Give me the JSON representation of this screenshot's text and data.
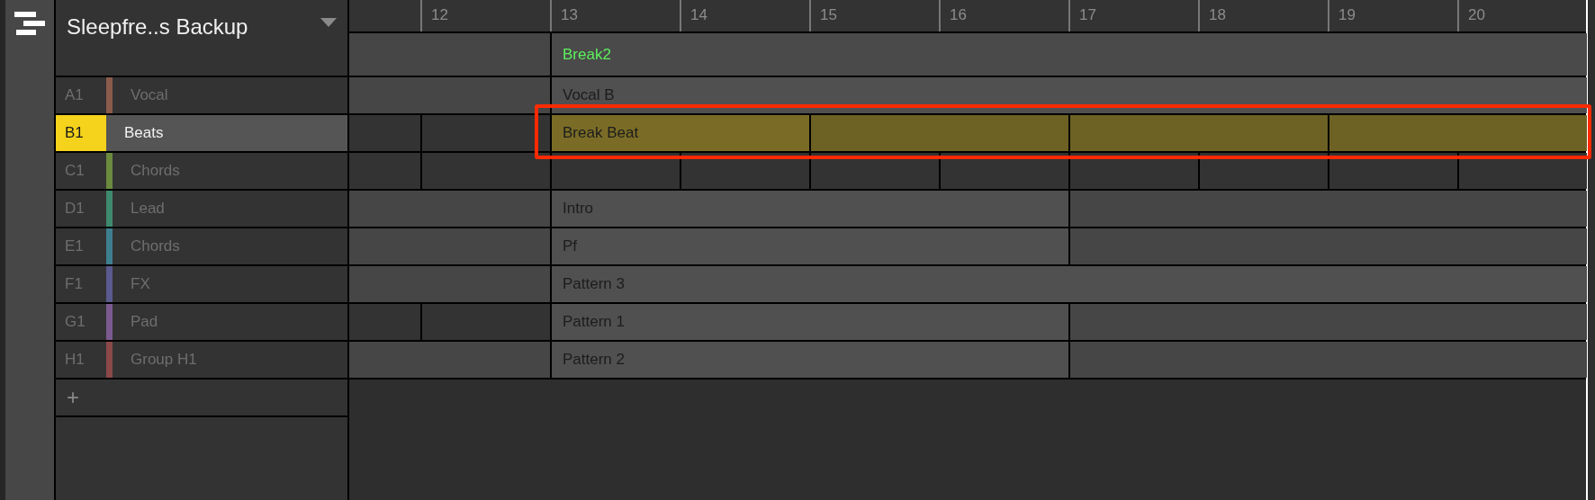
{
  "project": {
    "title": "Sleepfre..s Backup"
  },
  "ruler": [
    "12",
    "13",
    "14",
    "15",
    "16",
    "17",
    "18",
    "19",
    "20"
  ],
  "scene_row": {
    "slots": [
      {
        "kind": "region"
      },
      {
        "kind": "continue"
      },
      {
        "kind": "scene",
        "label": "Break2"
      },
      {
        "kind": "continue"
      },
      {
        "kind": "continue"
      },
      {
        "kind": "continue"
      },
      {
        "kind": "continue"
      },
      {
        "kind": "continue"
      },
      {
        "kind": "continue"
      },
      {
        "kind": "continue"
      }
    ]
  },
  "groups": [
    {
      "slot": "A1",
      "name": "Vocal",
      "color": "#8a5a4a",
      "selected": false,
      "framed": false,
      "slots": [
        {
          "kind": "region"
        },
        {
          "kind": "continue"
        },
        {
          "kind": "clip",
          "label": "Vocal B"
        },
        {
          "kind": "continue"
        },
        {
          "kind": "continue"
        },
        {
          "kind": "continue"
        },
        {
          "kind": "continue"
        },
        {
          "kind": "continue"
        },
        {
          "kind": "continue"
        },
        {
          "kind": "continue"
        }
      ]
    },
    {
      "slot": "B1",
      "name": "Beats",
      "color": "#f5d21b",
      "selected": true,
      "framed": true,
      "slots": [
        {
          "kind": "empty"
        },
        {
          "kind": "empty"
        },
        {
          "kind": "pattern",
          "label": "Break Beat"
        },
        {
          "kind": "continue"
        },
        {
          "kind": "loop"
        },
        {
          "kind": "continue"
        },
        {
          "kind": "loop"
        },
        {
          "kind": "continue"
        },
        {
          "kind": "loop"
        },
        {
          "kind": "continue"
        }
      ]
    },
    {
      "slot": "C1",
      "name": "Chords",
      "color": "#6b8a3e",
      "selected": false,
      "framed": false,
      "slots": [
        {
          "kind": "empty"
        },
        {
          "kind": "empty"
        },
        {
          "kind": "empty"
        },
        {
          "kind": "empty"
        },
        {
          "kind": "empty"
        },
        {
          "kind": "empty"
        },
        {
          "kind": "empty"
        },
        {
          "kind": "empty"
        },
        {
          "kind": "empty"
        },
        {
          "kind": "empty"
        }
      ]
    },
    {
      "slot": "D1",
      "name": "Lead",
      "color": "#3e8a6e",
      "selected": false,
      "framed": false,
      "slots": [
        {
          "kind": "region"
        },
        {
          "kind": "continue"
        },
        {
          "kind": "clip",
          "label": "Intro"
        },
        {
          "kind": "continue"
        },
        {
          "kind": "continue"
        },
        {
          "kind": "continue"
        },
        {
          "kind": "region"
        },
        {
          "kind": "continue"
        },
        {
          "kind": "continue"
        },
        {
          "kind": "continue"
        }
      ]
    },
    {
      "slot": "E1",
      "name": "Chords",
      "color": "#3e7f8f",
      "selected": false,
      "framed": false,
      "slots": [
        {
          "kind": "region"
        },
        {
          "kind": "continue"
        },
        {
          "kind": "clip",
          "label": "Pf"
        },
        {
          "kind": "continue"
        },
        {
          "kind": "continue"
        },
        {
          "kind": "continue"
        },
        {
          "kind": "region"
        },
        {
          "kind": "continue"
        },
        {
          "kind": "continue"
        },
        {
          "kind": "continue"
        }
      ]
    },
    {
      "slot": "F1",
      "name": "FX",
      "color": "#5a5a8f",
      "selected": false,
      "framed": false,
      "slots": [
        {
          "kind": "region"
        },
        {
          "kind": "continue"
        },
        {
          "kind": "clip",
          "label": "Pattern 3"
        },
        {
          "kind": "continue"
        },
        {
          "kind": "continue"
        },
        {
          "kind": "continue"
        },
        {
          "kind": "continue"
        },
        {
          "kind": "continue"
        },
        {
          "kind": "continue"
        },
        {
          "kind": "continue"
        }
      ]
    },
    {
      "slot": "G1",
      "name": "Pad",
      "color": "#7a5a8f",
      "selected": false,
      "framed": false,
      "slots": [
        {
          "kind": "empty"
        },
        {
          "kind": "empty"
        },
        {
          "kind": "clip",
          "label": "Pattern 1"
        },
        {
          "kind": "continue"
        },
        {
          "kind": "continue"
        },
        {
          "kind": "continue"
        },
        {
          "kind": "region"
        },
        {
          "kind": "continue"
        },
        {
          "kind": "continue"
        },
        {
          "kind": "continue"
        }
      ]
    },
    {
      "slot": "H1",
      "name": "Group H1",
      "color": "#8a4848",
      "selected": false,
      "framed": false,
      "slots": [
        {
          "kind": "region"
        },
        {
          "kind": "continue"
        },
        {
          "kind": "clip",
          "label": "Pattern 2"
        },
        {
          "kind": "continue"
        },
        {
          "kind": "continue"
        },
        {
          "kind": "continue"
        },
        {
          "kind": "region"
        },
        {
          "kind": "continue"
        },
        {
          "kind": "continue"
        },
        {
          "kind": "continue"
        }
      ]
    }
  ],
  "add_label": "+"
}
